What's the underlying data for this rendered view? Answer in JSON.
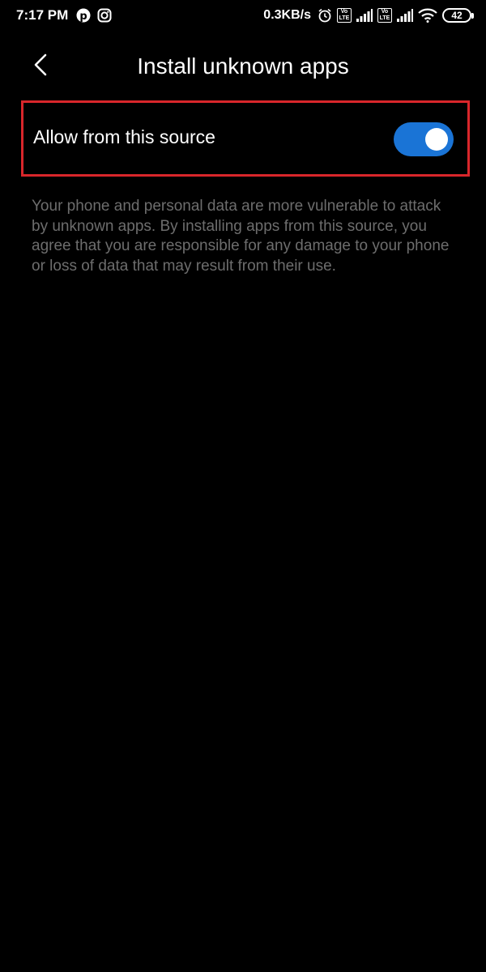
{
  "status_bar": {
    "time": "7:17 PM",
    "left_icons": [
      "pinterest-icon",
      "instagram-icon"
    ],
    "network_speed": "0.3KB/s",
    "right_icons": [
      "alarm-icon",
      "volte-icon",
      "signal-icon",
      "volte-icon",
      "signal-icon",
      "wifi-icon"
    ],
    "volte_label_top": "Vo",
    "volte_label_bottom": "LTE",
    "battery_level": "42"
  },
  "header": {
    "back_icon": "chevron-left-icon",
    "title": "Install unknown apps"
  },
  "setting": {
    "label": "Allow from this source",
    "toggle_on": true,
    "toggle_color": "#1a74d6",
    "highlight_color": "#d9262b"
  },
  "description": "Your phone and personal data are more vulnerable to attack by unknown apps. By installing apps from this source, you agree that you are responsible for any damage to your phone or loss of data that may result from their use."
}
